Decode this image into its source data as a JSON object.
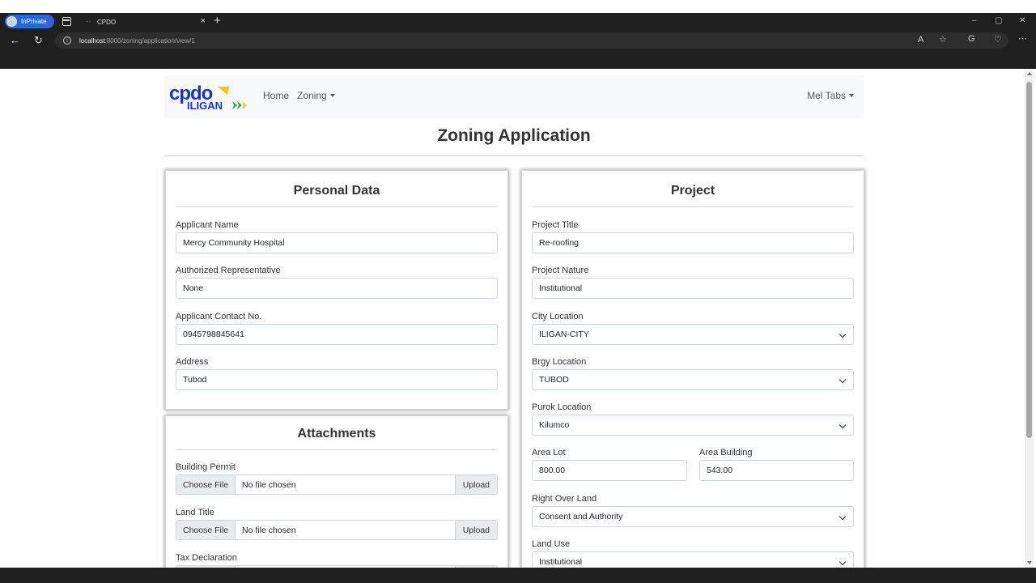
{
  "browser": {
    "inprivate_label": "InPrivate",
    "tab_title": "CPDO",
    "tab_close": "×",
    "new_tab": "+",
    "url_host": "localhost",
    "url_path": ":8000/zoning/application/view/1",
    "window_controls": [
      "–",
      "▢",
      "✕"
    ]
  },
  "navbar": {
    "logo_text": "cpdo",
    "logo_subtext": "ILIGAN",
    "home": "Home",
    "zoning": "Zoning",
    "user": "Mel Tabs"
  },
  "page": {
    "title": "Zoning Application"
  },
  "personal": {
    "title": "Personal Data",
    "fields": [
      {
        "label": "Applicant Name",
        "value": "Mercy Community Hospital"
      },
      {
        "label": "Authorized Representative",
        "value": "None"
      },
      {
        "label": "Applicant Contact No.",
        "value": "0945798845641"
      },
      {
        "label": "Address",
        "value": "Tubod"
      }
    ]
  },
  "attachments": {
    "title": "Attachments",
    "choose_label": "Choose File",
    "no_file": "No file chosen",
    "upload_label": "Upload",
    "items": [
      "Building Permit",
      "Land Title",
      "Tax Declaration"
    ]
  },
  "project": {
    "title": "Project",
    "project_title": {
      "label": "Project Title",
      "value": "Re-roofing"
    },
    "project_nature": {
      "label": "Project Nature",
      "value": "Institutional"
    },
    "city_location": {
      "label": "City Location",
      "value": "ILIGAN-CITY"
    },
    "brgy_location": {
      "label": "Brgy Location",
      "value": "TUBOD"
    },
    "purok_location": {
      "label": "Purok Location",
      "value": "Kilumco"
    },
    "area_lot": {
      "label": "Area Lot",
      "value": "800.00"
    },
    "area_building": {
      "label": "Area Building",
      "value": "543.00"
    },
    "right_over_land": {
      "label": "Right Over Land",
      "value": "Consent and Authority"
    },
    "land_use": {
      "label": "Land Use",
      "value": "Institutional"
    }
  },
  "colors": {
    "brand_blue": "#1a33c8",
    "brand_green": "#2fa84f",
    "brand_yellow": "#f2c318"
  }
}
